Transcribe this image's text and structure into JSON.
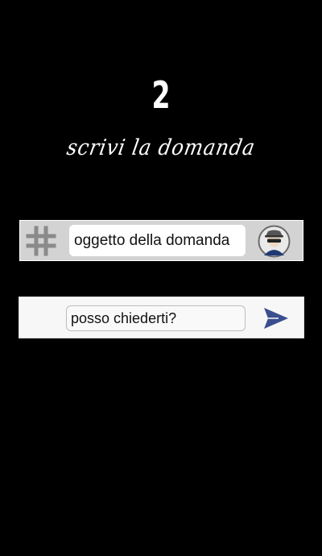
{
  "step": {
    "number": "2",
    "instruction": "scrivi la domanda"
  },
  "subject": {
    "icon": "hash-icon",
    "value": "oggetto della domanda",
    "avatar_icon": "incognito-avatar-icon"
  },
  "message": {
    "value": "posso chiederti?",
    "send_icon": "send-icon"
  },
  "colors": {
    "background": "#000000",
    "subject_bar": "#d3d3d3",
    "message_bar": "#f7f7f7",
    "send_icon": "#3a4f8f",
    "hash_icon": "#8a8a8a"
  }
}
